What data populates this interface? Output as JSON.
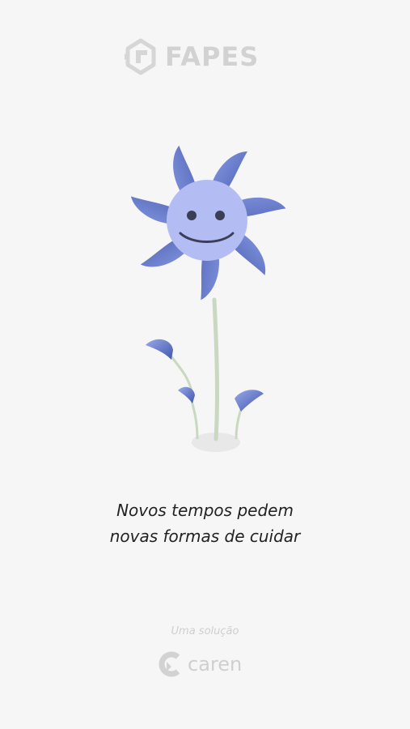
{
  "brand": {
    "name": "FAPES",
    "logo_icon": "fapes-logo-icon",
    "color": "#d2d2d2"
  },
  "illustration": {
    "name": "smiling-flower-illustration",
    "petal_color_dark": "#3e56ac",
    "petal_color_light": "#8f9fe6",
    "face_color": "#b3bdf4",
    "stem_color": "#c9d8c0"
  },
  "tagline": {
    "line1": "Novos tempos pedem",
    "line2": "novas formas de cuidar"
  },
  "footer": {
    "caption": "Uma solução",
    "partner_name": "caren",
    "partner_icon": "caren-logo-icon"
  }
}
